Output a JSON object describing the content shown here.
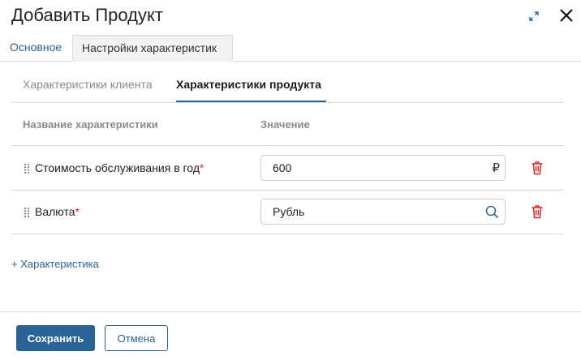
{
  "dialog": {
    "title": "Добавить Продукт",
    "icons": {
      "expand": "expand-icon",
      "close": "close-icon"
    }
  },
  "tabs": [
    {
      "label": "Основное",
      "active": false
    },
    {
      "label": "Настройки характеристик",
      "active": true
    }
  ],
  "subtabs": [
    {
      "label": "Характеристики клиента",
      "active": false
    },
    {
      "label": "Характеристики продукта",
      "active": true
    }
  ],
  "table": {
    "headers": {
      "name": "Название характеристики",
      "value": "Значение"
    },
    "rows": [
      {
        "name": "Стоимость обслуживания в год",
        "required_mark": "*",
        "value": "600",
        "suffix": "₽"
      },
      {
        "name": "Валюта",
        "required_mark": "*",
        "value": "Рубль",
        "suffix_icon": "search-icon"
      }
    ]
  },
  "add_characteristic": "+ Характеристика",
  "footer": {
    "save": "Сохранить",
    "cancel": "Отмена"
  },
  "colors": {
    "accent": "#2a6496",
    "required": "#d8262c",
    "delete": "#d8262c"
  }
}
